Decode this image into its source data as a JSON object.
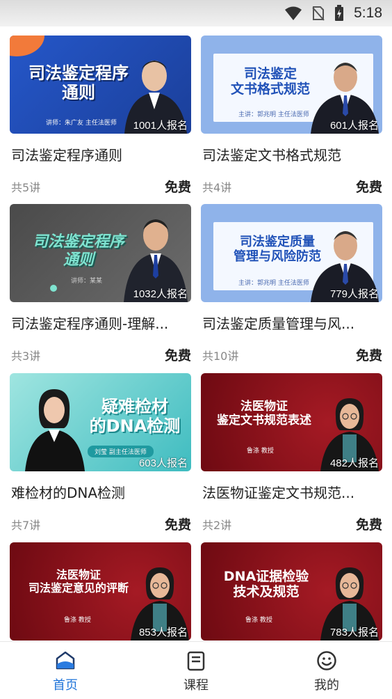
{
  "status_bar": {
    "time": "5:18",
    "icons": [
      "wifi-icon",
      "no-sim-icon",
      "battery-charging-icon"
    ]
  },
  "courses": [
    {
      "thumb_title": "司法鉴定程序\n通则",
      "thumb_sub": "讲师：朱广友 主任法医师",
      "enrolled": "1001人报名",
      "title": "司法鉴定程序通则",
      "lessons": "共5讲",
      "price": "免费"
    },
    {
      "thumb_title": "司法鉴定\n文书格式规范",
      "thumb_sub": "主讲：郭兆明 主任法医师",
      "enrolled": "601人报名",
      "title": "司法鉴定文书格式规范",
      "lessons": "共4讲",
      "price": "免费"
    },
    {
      "thumb_title": "司法鉴定程序\n通则",
      "thumb_sub": "讲师：某某",
      "enrolled": "1032人报名",
      "title": "司法鉴定程序通则-理解...",
      "lessons": "共3讲",
      "price": "免费"
    },
    {
      "thumb_title": "司法鉴定质量\n管理与风险防范",
      "thumb_sub": "主讲：郭兆明 主任法医师",
      "enrolled": "779人报名",
      "title": "司法鉴定质量管理与风...",
      "lessons": "共10讲",
      "price": "免费"
    },
    {
      "thumb_title": "疑难检材\n的DNA检测",
      "thumb_sub": "刘莹 副主任法医师",
      "enrolled": "603人报名",
      "title": "难检材的DNA检测",
      "lessons": "共7讲",
      "price": "免费"
    },
    {
      "thumb_title": "法医物证\n鉴定文书规范表述",
      "thumb_sub": "鲁涤 教授",
      "enrolled": "482人报名",
      "title": "法医物证鉴定文书规范...",
      "lessons": "共2讲",
      "price": "免费"
    },
    {
      "thumb_title": "法医物证\n司法鉴定意见的评断",
      "thumb_sub": "鲁涤 教授",
      "enrolled": "853人报名",
      "title": "",
      "lessons": "",
      "price": ""
    },
    {
      "thumb_title": "DNA证据检验\n技术及规范",
      "thumb_sub": "鲁涤 教授",
      "enrolled": "783人报名",
      "title": "",
      "lessons": "",
      "price": ""
    }
  ],
  "tab_bar": [
    {
      "label": "首页",
      "icon": "home-icon",
      "active": true
    },
    {
      "label": "课程",
      "icon": "course-icon",
      "active": false
    },
    {
      "label": "我的",
      "icon": "smiley-icon",
      "active": false
    }
  ],
  "colors": {
    "accent": "#1f74d9",
    "blue_bg": "#8fb3ea",
    "red_bg": "#8c0f18",
    "teal_bg": "#3fbcc0"
  }
}
